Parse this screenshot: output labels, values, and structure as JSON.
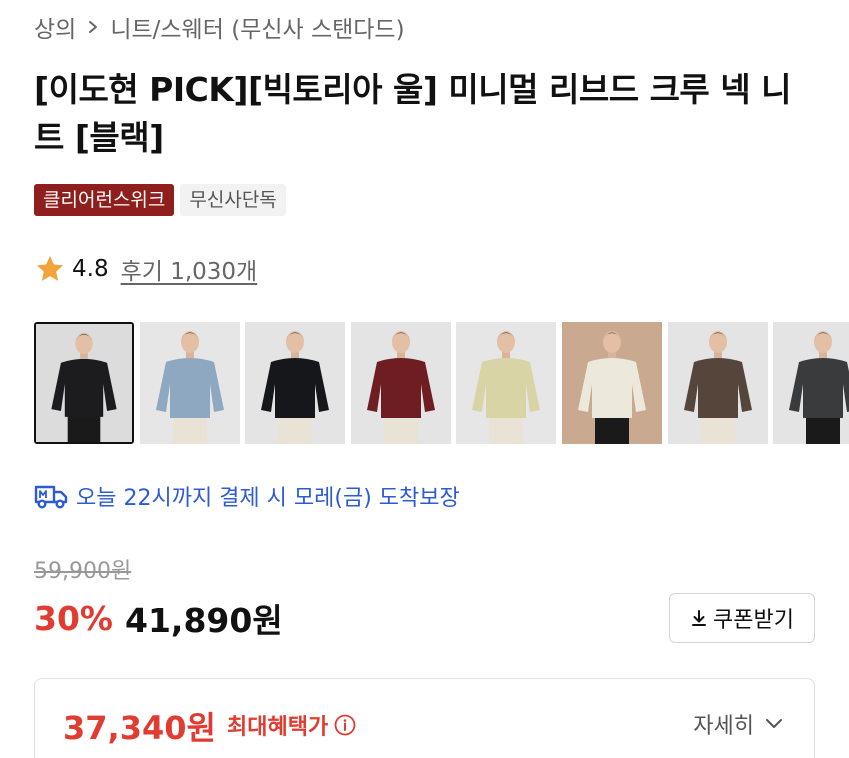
{
  "breadcrumb": {
    "category": "상의",
    "subcategory": "니트/스웨터 (무신사 스탠다드)"
  },
  "product": {
    "title": "[이도현 PICK][빅토리아 울] 미니멀 리브드 크루 넥 니트 [블랙]"
  },
  "badges": [
    "클리어런스위크",
    "무신사단독"
  ],
  "rating": {
    "score": "4.8",
    "reviews": "후기 1,030개",
    "star_color": "#f2a33a"
  },
  "thumbnails": [
    {
      "label": "black",
      "color": "#1c1c1e",
      "bg": "#dcdcdc"
    },
    {
      "label": "light-blue",
      "color": "#8fa8c2",
      "bg": "#e6e6e6"
    },
    {
      "label": "black",
      "color": "#16171b",
      "bg": "#e4e4e4"
    },
    {
      "label": "burgundy",
      "color": "#6e1e22",
      "bg": "#e4e4e4"
    },
    {
      "label": "light-khaki",
      "color": "#d8d4a6",
      "bg": "#e6e6e6"
    },
    {
      "label": "ivory",
      "color": "#ede8dc",
      "bg": "#c9a98f"
    },
    {
      "label": "brown",
      "color": "#55453a",
      "bg": "#e4e4e4"
    },
    {
      "label": "charcoal",
      "color": "#3a3b3d",
      "bg": "#e4e4e4"
    }
  ],
  "delivery": {
    "text": "오늘 22시까지 결제 시 모레(금) 도착보장",
    "icon": "truck-icon",
    "color": "#2d5bd3"
  },
  "pricing": {
    "original": "59,900원",
    "discount": "30%",
    "price": "41,890원",
    "coupon_label": "쿠폰받기",
    "discount_color": "#e03c31"
  },
  "benefit": {
    "max_price": "37,340원",
    "label": "최대혜택가",
    "detail_label": "자세히"
  }
}
